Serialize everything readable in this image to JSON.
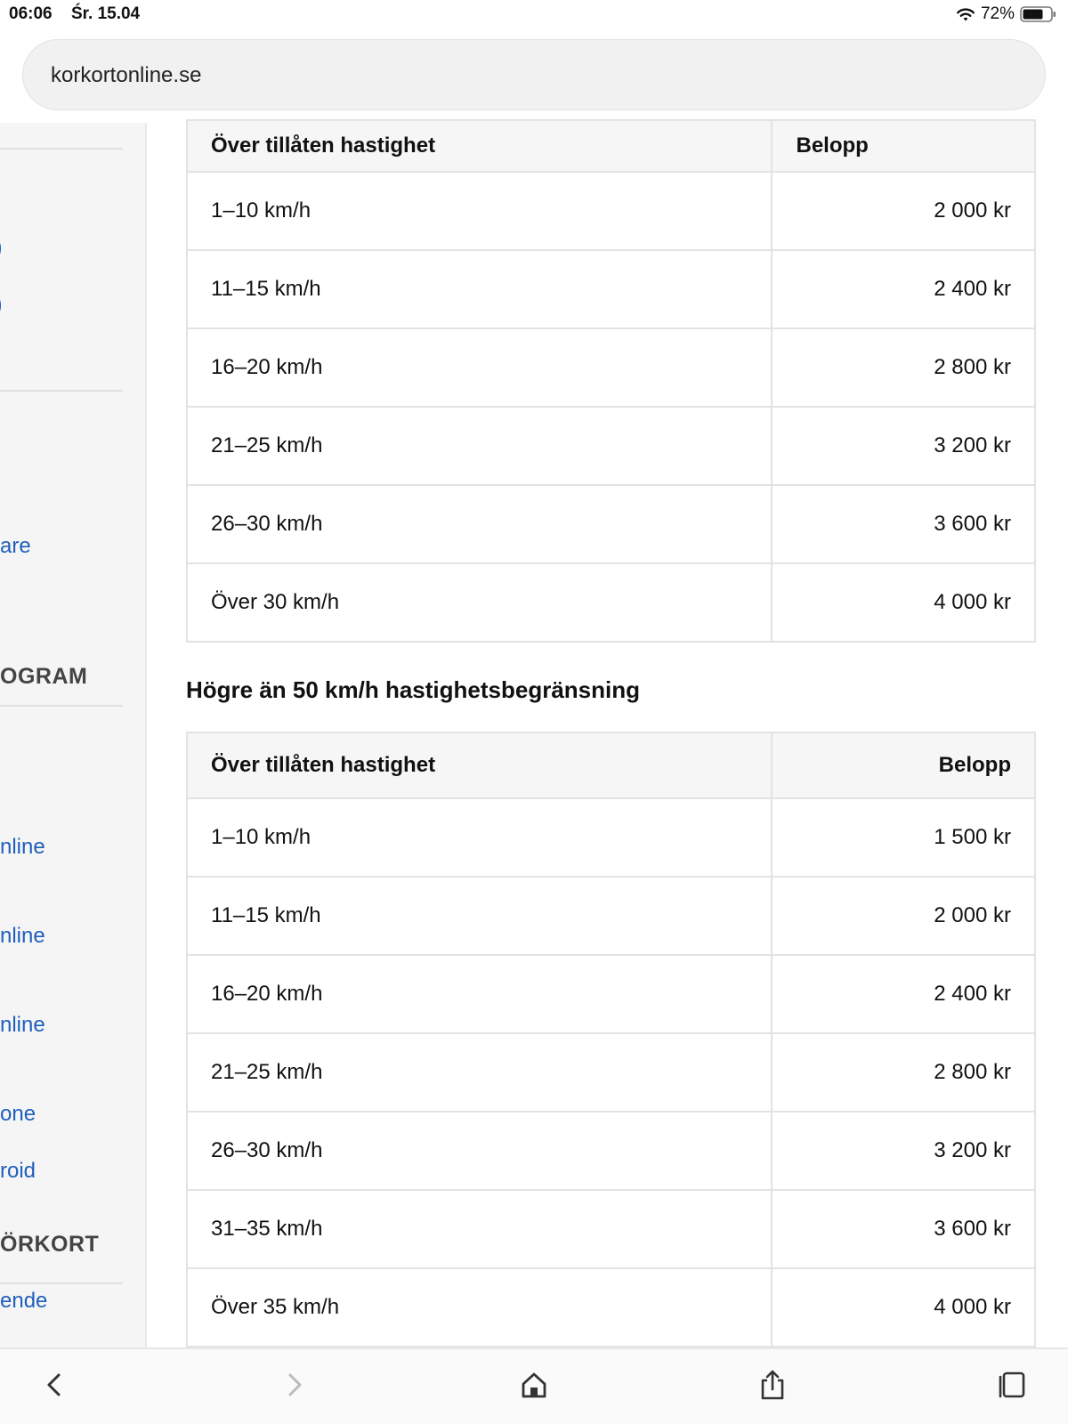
{
  "status": {
    "time": "06:06",
    "date": "Śr. 15.04",
    "battery": "72%"
  },
  "browser": {
    "url": "korkortonline.se"
  },
  "sidebar": {
    "paren_1": ")",
    "paren_2": ")",
    "link_1": "are",
    "heading_1": "OGRAM",
    "link_2": "nline",
    "link_3": "nline",
    "link_4": "nline",
    "link_5": "one",
    "link_6": "roid",
    "heading_2": "ÖRKORT",
    "link_7": "ende"
  },
  "table1": {
    "headers": [
      "Över tillåten hastighet",
      "Belopp"
    ],
    "rows": [
      [
        "1–10 km/h",
        "2 000 kr"
      ],
      [
        "11–15 km/h",
        "2 400 kr"
      ],
      [
        "16–20 km/h",
        "2 800 kr"
      ],
      [
        "21–25 km/h",
        "3 200 kr"
      ],
      [
        "26–30 km/h",
        "3 600 kr"
      ],
      [
        "Över 30 km/h",
        "4 000 kr"
      ]
    ]
  },
  "section2": {
    "heading": "Högre än 50 km/h hastighetsbegränsning"
  },
  "table2": {
    "headers": [
      "Över tillåten hastighet",
      "Belopp"
    ],
    "rows": [
      [
        "1–10 km/h",
        "1 500 kr"
      ],
      [
        "11–15 km/h",
        "2 000 kr"
      ],
      [
        "16–20 km/h",
        "2 400 kr"
      ],
      [
        "21–25 km/h",
        "2 800 kr"
      ],
      [
        "26–30 km/h",
        "3 200 kr"
      ],
      [
        "31–35 km/h",
        "3 600 kr"
      ],
      [
        "Över 35 km/h",
        "4 000 kr"
      ]
    ]
  },
  "toolbar": {
    "icons": [
      "back-icon",
      "forward-icon",
      "home-icon",
      "share-icon",
      "tabs-icon"
    ]
  }
}
